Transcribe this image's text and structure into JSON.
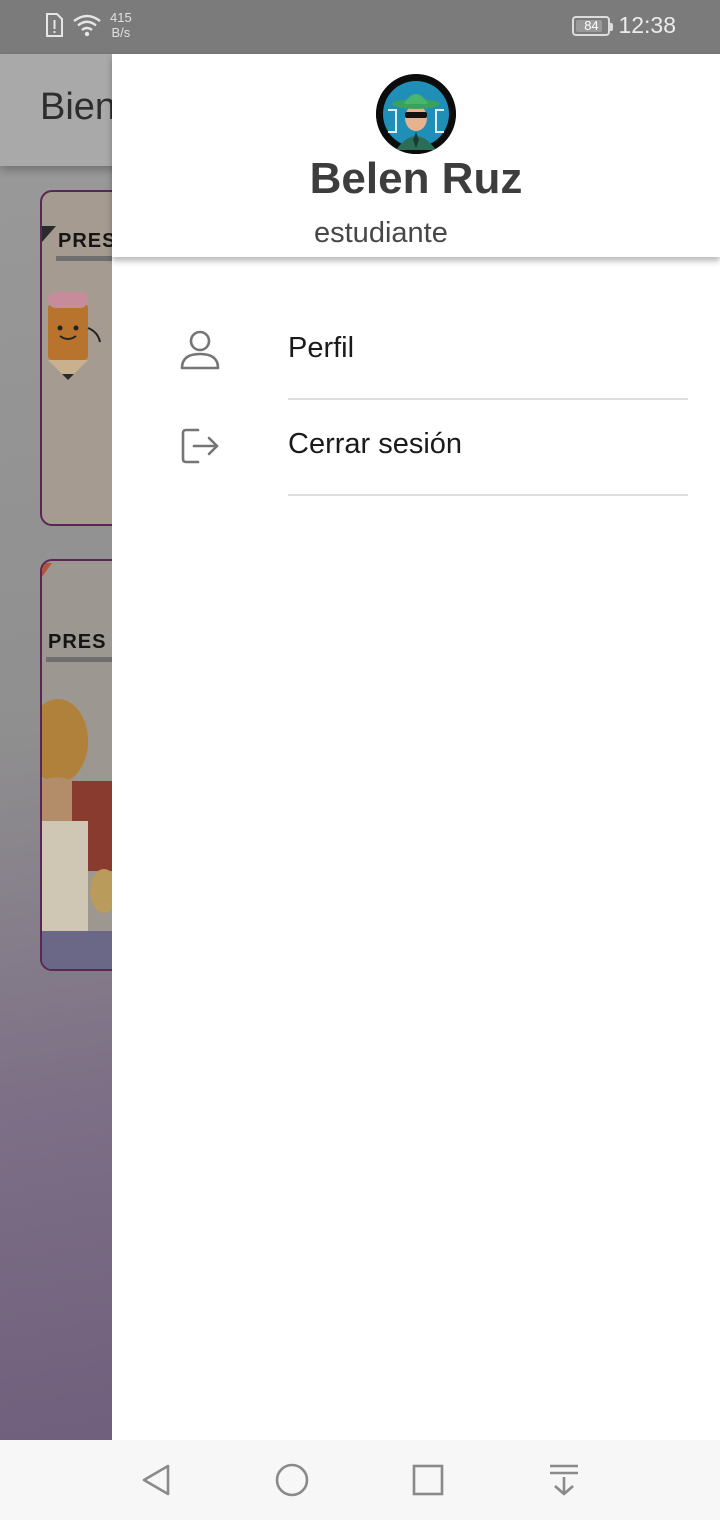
{
  "status_bar": {
    "net_speed_value": "415",
    "net_speed_unit": "B/s",
    "battery_level": "84",
    "time": "12:38"
  },
  "background_app": {
    "title": "Bien",
    "cards": [
      {
        "heading": "PRES"
      },
      {
        "heading": "PRES"
      }
    ]
  },
  "drawer": {
    "user_name": "Belen Ruz",
    "user_role": "estudiante",
    "menu": [
      {
        "label": "Perfil",
        "icon": "person-icon"
      },
      {
        "label": "Cerrar sesión",
        "icon": "logout-icon"
      }
    ]
  },
  "colors": {
    "drawer_bg": "#ffffff",
    "scrim": "#7b7b7b",
    "card_border": "#5a2656",
    "avatar_bg": "#0c0c0c",
    "icon_gray": "#757575"
  },
  "nav_bar": {
    "buttons": [
      "back-icon",
      "home-icon",
      "recents-icon",
      "notification-pull-icon"
    ]
  }
}
